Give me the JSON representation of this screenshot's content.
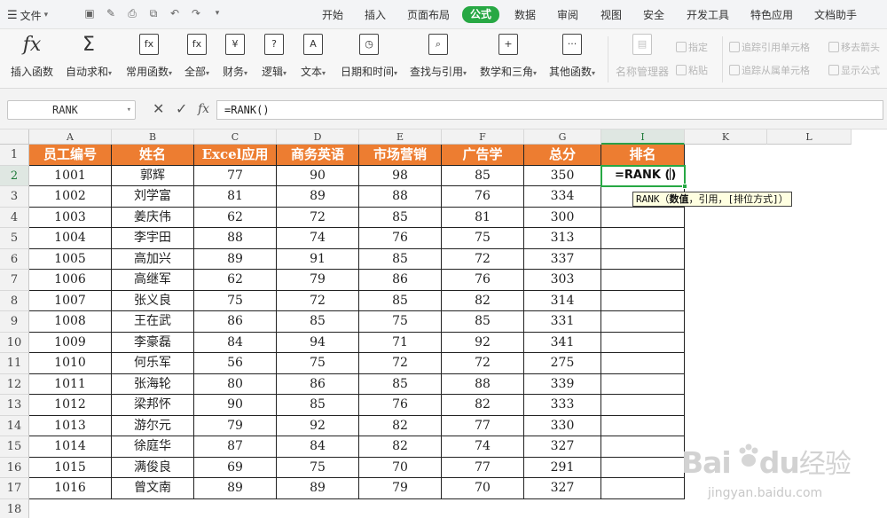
{
  "menubar": {
    "file_label": "文件",
    "tabs": [
      {
        "label": "开始",
        "active": false
      },
      {
        "label": "插入",
        "active": false
      },
      {
        "label": "页面布局",
        "active": false
      },
      {
        "label": "公式",
        "active": true
      },
      {
        "label": "数据",
        "active": false
      },
      {
        "label": "审阅",
        "active": false
      },
      {
        "label": "视图",
        "active": false
      },
      {
        "label": "安全",
        "active": false
      },
      {
        "label": "开发工具",
        "active": false
      },
      {
        "label": "特色应用",
        "active": false
      },
      {
        "label": "文档助手",
        "active": false
      }
    ],
    "accent_color": "#27a844"
  },
  "ribbon": {
    "insert_function": "插入函数",
    "autosum": "自动求和",
    "common_functions": "常用函数",
    "all": "全部",
    "finance": "财务",
    "logic": "逻辑",
    "text": "文本",
    "datetime": "日期和时间",
    "lookup": "查找与引用",
    "math": "数学和三角",
    "other": "其他函数",
    "name_manager": "名称管理器",
    "define": "指定",
    "paste": "粘贴",
    "trace_precedents": "追踪引用单元格",
    "trace_dependents": "追踪从属单元格",
    "remove_arrows": "移去箭头",
    "show_formulas": "显示公式"
  },
  "formula_bar": {
    "name_box": "RANK",
    "fx_label": "fx",
    "formula": "=RANK()"
  },
  "sheet": {
    "columns": [
      "A",
      "B",
      "C",
      "D",
      "E",
      "F",
      "G",
      "I",
      "K",
      "L"
    ],
    "selected_column": "I",
    "rows": [
      "1",
      "2",
      "3",
      "4",
      "5",
      "6",
      "7",
      "8",
      "9",
      "10",
      "11",
      "12",
      "13",
      "14",
      "15",
      "16",
      "17",
      "18"
    ],
    "selected_row": "2",
    "headers": [
      "员工编号",
      "姓名",
      "Excel应用",
      "商务英语",
      "市场营销",
      "广告学",
      "总分",
      "排名"
    ],
    "header_color": "#ed7d31",
    "data": [
      [
        "1001",
        "郭辉",
        "77",
        "90",
        "98",
        "85",
        "350"
      ],
      [
        "1002",
        "刘学富",
        "81",
        "89",
        "88",
        "76",
        "334"
      ],
      [
        "1003",
        "姜庆伟",
        "62",
        "72",
        "85",
        "81",
        "300"
      ],
      [
        "1004",
        "李宇田",
        "88",
        "74",
        "76",
        "75",
        "313"
      ],
      [
        "1005",
        "高加兴",
        "89",
        "91",
        "85",
        "72",
        "337"
      ],
      [
        "1006",
        "高继军",
        "62",
        "79",
        "86",
        "76",
        "303"
      ],
      [
        "1007",
        "张义良",
        "75",
        "72",
        "85",
        "82",
        "314"
      ],
      [
        "1008",
        "王在武",
        "86",
        "85",
        "75",
        "85",
        "331"
      ],
      [
        "1009",
        "李豪磊",
        "84",
        "94",
        "71",
        "92",
        "341"
      ],
      [
        "1010",
        "何乐军",
        "56",
        "75",
        "72",
        "72",
        "275"
      ],
      [
        "1011",
        "张海轮",
        "80",
        "86",
        "85",
        "88",
        "339"
      ],
      [
        "1012",
        "梁邦怀",
        "90",
        "85",
        "76",
        "82",
        "333"
      ],
      [
        "1013",
        "游尔元",
        "79",
        "92",
        "82",
        "77",
        "330"
      ],
      [
        "1014",
        "徐庭华",
        "87",
        "84",
        "82",
        "74",
        "327"
      ],
      [
        "1015",
        "满俊良",
        "69",
        "75",
        "70",
        "77",
        "291"
      ],
      [
        "1016",
        "曾文南",
        "89",
        "89",
        "79",
        "70",
        "327"
      ]
    ],
    "active_cell_text": "=RANK (",
    "active_cell_close": ")",
    "tooltip_fn": "RANK（",
    "tooltip_arg1": "数值",
    "tooltip_rest": "，引用，[排位方式]）"
  },
  "watermark": {
    "brand": "Bai",
    "brand2": "du",
    "brand3": "经验",
    "url": "jingyan.baidu.com"
  }
}
